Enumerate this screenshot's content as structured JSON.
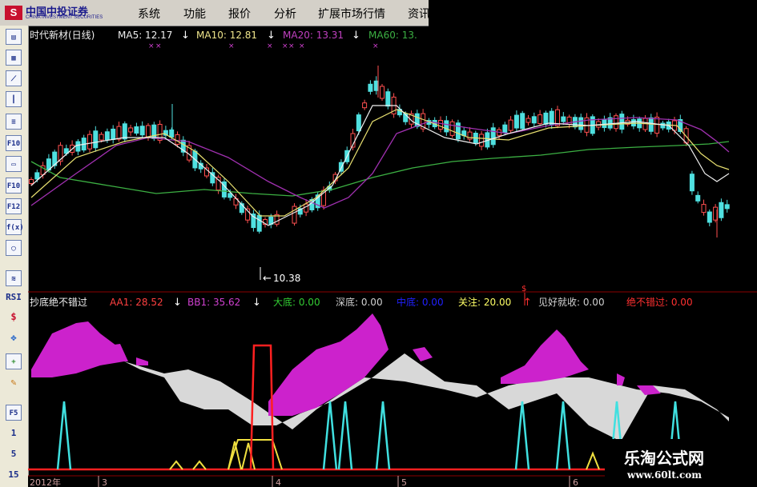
{
  "logo": {
    "cn": "中国中投证券",
    "en": "CHINA INVESTMENT SECURITIES"
  },
  "menu": [
    "系统",
    "功能",
    "报价",
    "分析",
    "扩展市场行情",
    "资讯"
  ],
  "toolbar": [
    "F10",
    "F10",
    "F12",
    "f(x)",
    "RSI",
    "$",
    "F5",
    "1",
    "5",
    "15"
  ],
  "main_chart": {
    "stock": "时代新材(日线)",
    "indicators": [
      {
        "label": "MA5: 12.17",
        "color": "#f0f0f0"
      },
      {
        "label": "MA10: 12.81",
        "color": "#f0e68c"
      },
      {
        "label": "MA20: 13.31",
        "color": "#c040c0"
      },
      {
        "label": "MA60: 13.",
        "color": "#3cb043"
      }
    ],
    "low_label": "10.38"
  },
  "sub_chart": {
    "name": "抄底绝不错过",
    "indicators": [
      {
        "label": "AA1: 28.52",
        "color": "#ff4040"
      },
      {
        "label": "BB1: 35.62",
        "color": "#d040d0"
      },
      {
        "label": "大底: 0.00",
        "color": "#33cc33"
      },
      {
        "label": "深底: 0.00",
        "color": "#d0d0d0"
      },
      {
        "label": "中底: 0.00",
        "color": "#2020ff"
      },
      {
        "label": "关注: 20.00",
        "color": "#ffff66"
      },
      {
        "label": "见好就收: 0.00",
        "color": "#d0d0d0"
      },
      {
        "label": "绝不错过: 0.00",
        "color": "#ff3030"
      }
    ]
  },
  "date_axis": [
    "2012年",
    "3",
    "4",
    "5",
    "6"
  ],
  "watermark": {
    "big": "乐淘公式网",
    "small": "www.60lt.com"
  }
}
